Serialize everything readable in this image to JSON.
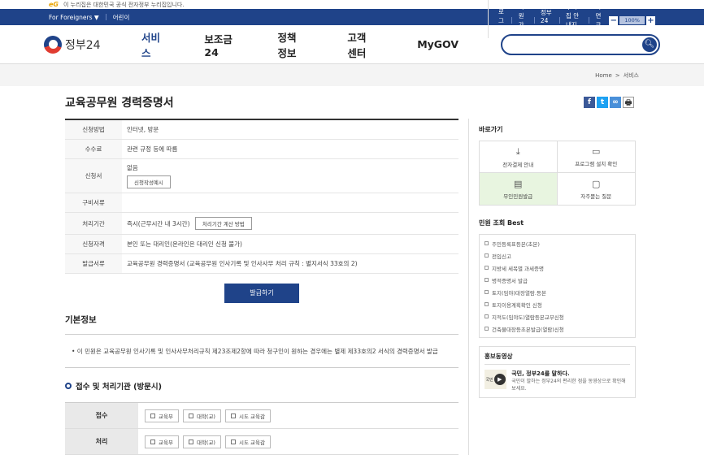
{
  "notice": {
    "mark": "eG",
    "text": "이 누리집은 대한민국 공식 전자정부 누리집입니다."
  },
  "topbar": {
    "foreigners": "For Foreigners ▼",
    "kids": "어린이",
    "links": [
      "로그인",
      "회원가입",
      "정부24소개",
      "누리집 안내지도",
      "화면크기"
    ],
    "zoom_minus": "−",
    "zoom_value": "100%",
    "zoom_plus": "+"
  },
  "gnb": {
    "logo": "정부24",
    "menu": [
      "서비스",
      "보조금24",
      "정책정보",
      "고객센터",
      "MyGOV"
    ],
    "active": 0,
    "search_placeholder": ""
  },
  "breadcrumb": {
    "home": "Home",
    "arrow": ">",
    "current": "서비스"
  },
  "page": {
    "title": "교육공무원 경력증명서",
    "print": "🖶"
  },
  "info": {
    "rows": [
      {
        "label": "신청방법",
        "value": "인터넷, 방문"
      },
      {
        "label": "수수료",
        "value": "관련 규정 등에 따름"
      },
      {
        "label": "신청서",
        "value": "없음",
        "button": "신청작성예시"
      },
      {
        "label": "구비서류",
        "value": ""
      },
      {
        "label": "처리기간",
        "value": "즉시(근무시간 내 3시간)",
        "button": "처리기간 계산 방법"
      },
      {
        "label": "신청자격",
        "value": "본인 또는 대리인(온라인은 대리인 신청 불가)"
      },
      {
        "label": "발급서류",
        "value": "교육공무원 경력증명서 (교육공무원 인사기록 및 인사사무 처리 규칙 : 별지서식 33호의 2)"
      }
    ],
    "issue_button": "발급하기"
  },
  "basic": {
    "heading": "기본정보",
    "desc": "• 이 민원은 교육공무원 인사기록 및 인사사무처리규칙 제23조제2항에 따라 청구인이 원하는 경우에는 별제 제33호의2 서식의 경력증명서 발급"
  },
  "process": {
    "heading": "접수 및 처리기관 (방문시)",
    "rows": [
      {
        "label": "접수",
        "chips": [
          "교육부",
          "대학(교)",
          "시도 교육감"
        ]
      },
      {
        "label": "처리",
        "chips": [
          "교육부",
          "대학(교)",
          "시도 교육감"
        ]
      }
    ]
  },
  "shortcut": {
    "title": "바로가기",
    "items": [
      {
        "label": "전자결제 안내",
        "icon": "download-icon",
        "glyph": "⤓"
      },
      {
        "label": "프로그램 설치 확인",
        "icon": "monitor-icon",
        "glyph": "▭"
      },
      {
        "label": "무인민원발급",
        "icon": "kiosk-icon",
        "glyph": "▤"
      },
      {
        "label": "자주묻는 질문",
        "icon": "chat-icon",
        "glyph": "▢"
      }
    ]
  },
  "best": {
    "title": "민원 조회 Best",
    "items": [
      "주민등록표등본(초본)",
      "전입신고",
      "지방세 세목별 과세증명",
      "병적증명서 발급",
      "토지(임야)대장열람.등본",
      "토지이용계획확인 신청",
      "지적도(임야도)열람등본교부신청",
      "건축물대장등초본발급(열람)신청"
    ]
  },
  "promo": {
    "title": "홍보동영상",
    "thumb_text": "국민",
    "headline": "국민, 정부24를 말하다.",
    "body": "국민이 말하는 정부24의 편리한 점을 동영상으로 확인해 보세요."
  },
  "colors": {
    "primary": "#1f4389",
    "highlight": "#e8f5e0",
    "accent": "#e8a200"
  }
}
